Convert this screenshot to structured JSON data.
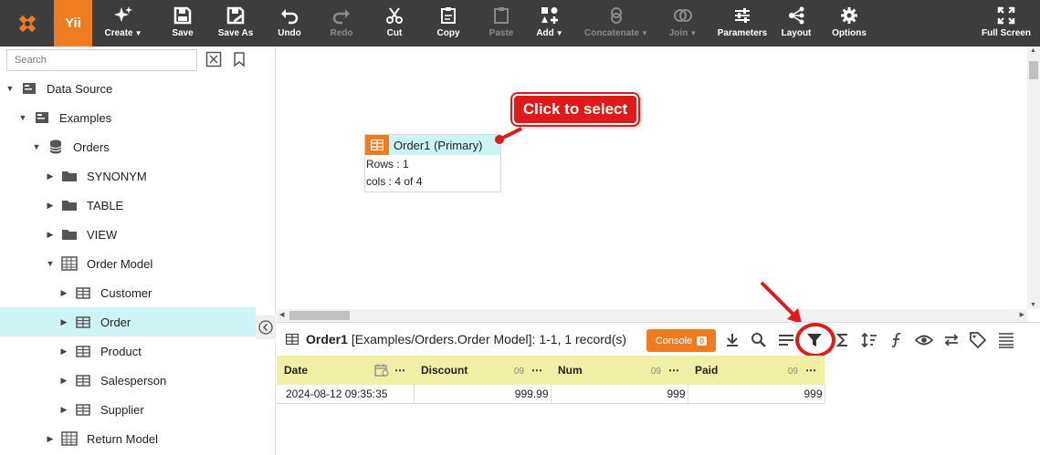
{
  "logo": {
    "short": "Yii"
  },
  "toolbar": {
    "buttons": [
      {
        "label": "Create",
        "icon": "sparkle-icon",
        "enabled": true,
        "dropdown": true
      },
      {
        "label": "Save",
        "icon": "save-icon",
        "enabled": true
      },
      {
        "label": "Save As",
        "icon": "save-as-icon",
        "enabled": true
      },
      {
        "label": "Undo",
        "icon": "undo-icon",
        "enabled": true
      },
      {
        "label": "Redo",
        "icon": "redo-icon",
        "enabled": false
      },
      {
        "label": "Cut",
        "icon": "scissors-icon",
        "enabled": true
      },
      {
        "label": "Copy",
        "icon": "copy-icon",
        "enabled": true
      },
      {
        "label": "Paste",
        "icon": "paste-icon",
        "enabled": false
      },
      {
        "label": "Add",
        "icon": "add-shapes-icon",
        "enabled": true,
        "dropdown": true
      },
      {
        "label": "Concatenate",
        "icon": "concatenate-icon",
        "enabled": false,
        "dropdown": true
      },
      {
        "label": "Join",
        "icon": "join-icon",
        "enabled": false,
        "dropdown": true
      },
      {
        "label": "Parameters",
        "icon": "sliders-icon",
        "enabled": true
      },
      {
        "label": "Layout",
        "icon": "layout-tree-icon",
        "enabled": true
      },
      {
        "label": "Options",
        "icon": "gear-icon",
        "enabled": true
      },
      {
        "label": "Full Screen",
        "icon": "fullscreen-icon",
        "enabled": true
      }
    ]
  },
  "sidebar": {
    "search_placeholder": "Search",
    "tree": [
      {
        "label": "Data Source",
        "icon": "datasource-icon",
        "level": 0,
        "expanded": true
      },
      {
        "label": "Examples",
        "icon": "datasource-icon",
        "level": 1,
        "expanded": true
      },
      {
        "label": "Orders",
        "icon": "database-icon",
        "level": 2,
        "expanded": true
      },
      {
        "label": "SYNONYM",
        "icon": "folder-icon",
        "level": 3,
        "expanded": false
      },
      {
        "label": "TABLE",
        "icon": "folder-icon",
        "level": 3,
        "expanded": false
      },
      {
        "label": "VIEW",
        "icon": "folder-icon",
        "level": 3,
        "expanded": false
      },
      {
        "label": "Order Model",
        "icon": "model-icon",
        "level": 3,
        "expanded": true
      },
      {
        "label": "Customer",
        "icon": "table-icon",
        "level": 4,
        "expanded": false
      },
      {
        "label": "Order",
        "icon": "table-icon",
        "level": 4,
        "expanded": false,
        "selected": true
      },
      {
        "label": "Product",
        "icon": "table-icon",
        "level": 4,
        "expanded": false
      },
      {
        "label": "Salesperson",
        "icon": "table-icon",
        "level": 4,
        "expanded": false
      },
      {
        "label": "Supplier",
        "icon": "table-icon",
        "level": 4,
        "expanded": false
      },
      {
        "label": "Return Model",
        "icon": "model-icon",
        "level": 3,
        "expanded": false
      }
    ]
  },
  "canvas": {
    "node": {
      "title": "Order1 (Primary)",
      "rows": "Rows : 1",
      "cols": "cols : 4 of 4"
    },
    "callout": "Click to select"
  },
  "bottom": {
    "table_name": "Order1",
    "info": "[Examples/Orders.Order Model]: 1-1, 1 record(s)",
    "console_label": "Console",
    "console_count": "0",
    "tool_icons": [
      "download-icon",
      "search-icon",
      "sort-rows-icon",
      "filter-icon",
      "sigma-icon",
      "sort-icon",
      "formula-icon",
      "eye-icon",
      "swap-icon",
      "tag-icon",
      "list-icon"
    ],
    "highlighted_tool": "filter-icon",
    "columns": [
      {
        "name": "Date",
        "type_icon": "date-type-icon",
        "type_text": ""
      },
      {
        "name": "Discount",
        "type_icon": "number-type-icon",
        "type_text": "09"
      },
      {
        "name": "Num",
        "type_icon": "number-type-icon",
        "type_text": "09"
      },
      {
        "name": "Paid",
        "type_icon": "number-type-icon",
        "type_text": "09"
      }
    ],
    "rows": [
      [
        "2024-08-12 09:35:35",
        "999.99",
        "999",
        "999"
      ]
    ]
  },
  "colors": {
    "accent": "#f07c22",
    "toolbar": "#3d3d3d",
    "selected": "#ccf4f4",
    "header": "#f1efa5",
    "annotation": "#e01919"
  }
}
